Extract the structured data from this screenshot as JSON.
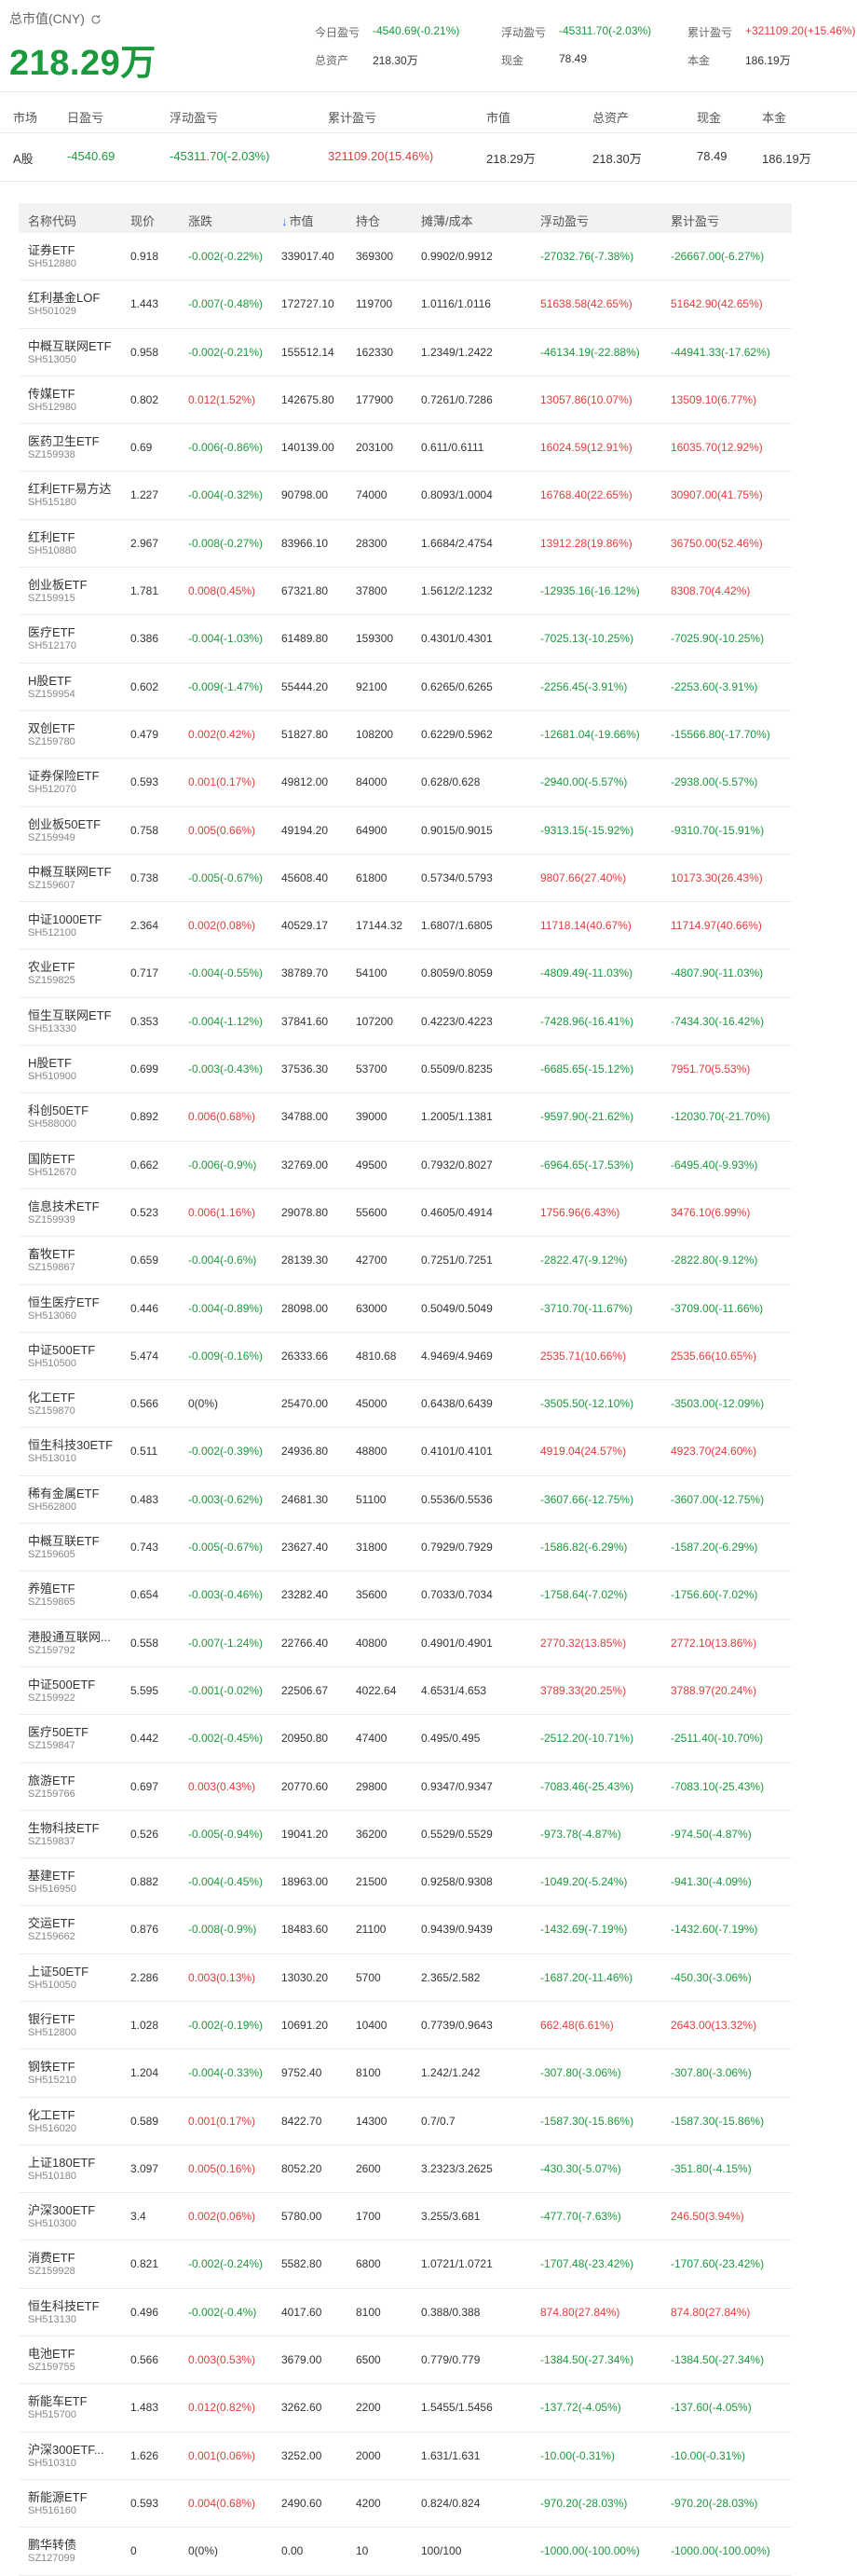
{
  "header": {
    "label": "总市值(CNY)",
    "value": "218.29万",
    "stats": {
      "today_label": "今日盈亏",
      "today_value": "-4540.69(-0.21%)",
      "float_label": "浮动盈亏",
      "float_value": "-45311.70(-2.03%)",
      "cum_label": "累计盈亏",
      "cum_value": "+321109.20(+15.46%)",
      "assets_label": "总资产",
      "assets_value": "218.30万",
      "cash_label": "现金",
      "cash_value": "78.49",
      "principal_label": "本金",
      "principal_value": "186.19万"
    }
  },
  "summary": {
    "headers": [
      "市场",
      "日盈亏",
      "浮动盈亏",
      "累计盈亏",
      "市值",
      "总资产",
      "现金",
      "本金"
    ],
    "row": [
      "A股",
      "-4540.69",
      "-45311.70(-2.03%)",
      "321109.20(15.46%)",
      "218.29万",
      "218.30万",
      "78.49",
      "186.19万"
    ]
  },
  "colors": {
    "gain": "#e23c3c",
    "loss": "#1a9a3c",
    "accent": "#3a6fd8"
  },
  "table": {
    "headers": [
      "名称代码",
      "现价",
      "涨跌",
      "市值",
      "持仓",
      "摊薄/成本",
      "浮动盈亏",
      "累计盈亏"
    ],
    "sort_icon": "arrow-down-icon",
    "rows": [
      {
        "name": "证券ETF",
        "code": "SH512880",
        "price": "0.918",
        "change": "-0.002(-0.22%)",
        "mv": "339017.40",
        "qty": "369300",
        "cost": "0.9902/0.9912",
        "fpl": "-27032.76(-7.38%)",
        "cpl": "-26667.00(-6.27%)"
      },
      {
        "name": "红利基金LOF",
        "code": "SH501029",
        "price": "1.443",
        "change": "-0.007(-0.48%)",
        "mv": "172727.10",
        "qty": "119700",
        "cost": "1.0116/1.0116",
        "fpl": "51638.58(42.65%)",
        "cpl": "51642.90(42.65%)"
      },
      {
        "name": "中概互联网ETF",
        "code": "SH513050",
        "price": "0.958",
        "change": "-0.002(-0.21%)",
        "mv": "155512.14",
        "qty": "162330",
        "cost": "1.2349/1.2422",
        "fpl": "-46134.19(-22.88%)",
        "cpl": "-44941.33(-17.62%)"
      },
      {
        "name": "传媒ETF",
        "code": "SH512980",
        "price": "0.802",
        "change": "0.012(1.52%)",
        "mv": "142675.80",
        "qty": "177900",
        "cost": "0.7261/0.7286",
        "fpl": "13057.86(10.07%)",
        "cpl": "13509.10(6.77%)"
      },
      {
        "name": "医药卫生ETF",
        "code": "SZ159938",
        "price": "0.69",
        "change": "-0.006(-0.86%)",
        "mv": "140139.00",
        "qty": "203100",
        "cost": "0.611/0.6111",
        "fpl": "16024.59(12.91%)",
        "cpl": "16035.70(12.92%)"
      },
      {
        "name": "红利ETF易方达",
        "code": "SH515180",
        "price": "1.227",
        "change": "-0.004(-0.32%)",
        "mv": "90798.00",
        "qty": "74000",
        "cost": "0.8093/1.0004",
        "fpl": "16768.40(22.65%)",
        "cpl": "30907.00(41.75%)"
      },
      {
        "name": "红利ETF",
        "code": "SH510880",
        "price": "2.967",
        "change": "-0.008(-0.27%)",
        "mv": "83966.10",
        "qty": "28300",
        "cost": "1.6684/2.4754",
        "fpl": "13912.28(19.86%)",
        "cpl": "36750.00(52.46%)"
      },
      {
        "name": "创业板ETF",
        "code": "SZ159915",
        "price": "1.781",
        "change": "0.008(0.45%)",
        "mv": "67321.80",
        "qty": "37800",
        "cost": "1.5612/2.1232",
        "fpl": "-12935.16(-16.12%)",
        "cpl": "8308.70(4.42%)"
      },
      {
        "name": "医疗ETF",
        "code": "SH512170",
        "price": "0.386",
        "change": "-0.004(-1.03%)",
        "mv": "61489.80",
        "qty": "159300",
        "cost": "0.4301/0.4301",
        "fpl": "-7025.13(-10.25%)",
        "cpl": "-7025.90(-10.25%)"
      },
      {
        "name": "H股ETF",
        "code": "SZ159954",
        "price": "0.602",
        "change": "-0.009(-1.47%)",
        "mv": "55444.20",
        "qty": "92100",
        "cost": "0.6265/0.6265",
        "fpl": "-2256.45(-3.91%)",
        "cpl": "-2253.60(-3.91%)"
      },
      {
        "name": "双创ETF",
        "code": "SZ159780",
        "price": "0.479",
        "change": "0.002(0.42%)",
        "mv": "51827.80",
        "qty": "108200",
        "cost": "0.6229/0.5962",
        "fpl": "-12681.04(-19.66%)",
        "cpl": "-15566.80(-17.70%)"
      },
      {
        "name": "证券保险ETF",
        "code": "SH512070",
        "price": "0.593",
        "change": "0.001(0.17%)",
        "mv": "49812.00",
        "qty": "84000",
        "cost": "0.628/0.628",
        "fpl": "-2940.00(-5.57%)",
        "cpl": "-2938.00(-5.57%)"
      },
      {
        "name": "创业板50ETF",
        "code": "SZ159949",
        "price": "0.758",
        "change": "0.005(0.66%)",
        "mv": "49194.20",
        "qty": "64900",
        "cost": "0.9015/0.9015",
        "fpl": "-9313.15(-15.92%)",
        "cpl": "-9310.70(-15.91%)"
      },
      {
        "name": "中概互联网ETF",
        "code": "SZ159607",
        "price": "0.738",
        "change": "-0.005(-0.67%)",
        "mv": "45608.40",
        "qty": "61800",
        "cost": "0.5734/0.5793",
        "fpl": "9807.66(27.40%)",
        "cpl": "10173.30(26.43%)"
      },
      {
        "name": "中证1000ETF",
        "code": "SH512100",
        "price": "2.364",
        "change": "0.002(0.08%)",
        "mv": "40529.17",
        "qty": "17144.32",
        "cost": "1.6807/1.6805",
        "fpl": "11718.14(40.67%)",
        "cpl": "11714.97(40.66%)"
      },
      {
        "name": "农业ETF",
        "code": "SZ159825",
        "price": "0.717",
        "change": "-0.004(-0.55%)",
        "mv": "38789.70",
        "qty": "54100",
        "cost": "0.8059/0.8059",
        "fpl": "-4809.49(-11.03%)",
        "cpl": "-4807.90(-11.03%)"
      },
      {
        "name": "恒生互联网ETF",
        "code": "SH513330",
        "price": "0.353",
        "change": "-0.004(-1.12%)",
        "mv": "37841.60",
        "qty": "107200",
        "cost": "0.4223/0.4223",
        "fpl": "-7428.96(-16.41%)",
        "cpl": "-7434.30(-16.42%)"
      },
      {
        "name": "H股ETF",
        "code": "SH510900",
        "price": "0.699",
        "change": "-0.003(-0.43%)",
        "mv": "37536.30",
        "qty": "53700",
        "cost": "0.5509/0.8235",
        "fpl": "-6685.65(-15.12%)",
        "cpl": "7951.70(5.53%)"
      },
      {
        "name": "科创50ETF",
        "code": "SH588000",
        "price": "0.892",
        "change": "0.006(0.68%)",
        "mv": "34788.00",
        "qty": "39000",
        "cost": "1.2005/1.1381",
        "fpl": "-9597.90(-21.62%)",
        "cpl": "-12030.70(-21.70%)"
      },
      {
        "name": "国防ETF",
        "code": "SH512670",
        "price": "0.662",
        "change": "-0.006(-0.9%)",
        "mv": "32769.00",
        "qty": "49500",
        "cost": "0.7932/0.8027",
        "fpl": "-6964.65(-17.53%)",
        "cpl": "-6495.40(-9.93%)"
      },
      {
        "name": "信息技术ETF",
        "code": "SZ159939",
        "price": "0.523",
        "change": "0.006(1.16%)",
        "mv": "29078.80",
        "qty": "55600",
        "cost": "0.4605/0.4914",
        "fpl": "1756.96(6.43%)",
        "cpl": "3476.10(6.99%)"
      },
      {
        "name": "畜牧ETF",
        "code": "SZ159867",
        "price": "0.659",
        "change": "-0.004(-0.6%)",
        "mv": "28139.30",
        "qty": "42700",
        "cost": "0.7251/0.7251",
        "fpl": "-2822.47(-9.12%)",
        "cpl": "-2822.80(-9.12%)"
      },
      {
        "name": "恒生医疗ETF",
        "code": "SH513060",
        "price": "0.446",
        "change": "-0.004(-0.89%)",
        "mv": "28098.00",
        "qty": "63000",
        "cost": "0.5049/0.5049",
        "fpl": "-3710.70(-11.67%)",
        "cpl": "-3709.00(-11.66%)"
      },
      {
        "name": "中证500ETF",
        "code": "SH510500",
        "price": "5.474",
        "change": "-0.009(-0.16%)",
        "mv": "26333.66",
        "qty": "4810.68",
        "cost": "4.9469/4.9469",
        "fpl": "2535.71(10.66%)",
        "cpl": "2535.66(10.65%)"
      },
      {
        "name": "化工ETF",
        "code": "SZ159870",
        "price": "0.566",
        "change": "0(0%)",
        "mv": "25470.00",
        "qty": "45000",
        "cost": "0.6438/0.6439",
        "fpl": "-3505.50(-12.10%)",
        "cpl": "-3503.00(-12.09%)"
      },
      {
        "name": "恒生科技30ETF",
        "code": "SH513010",
        "price": "0.511",
        "change": "-0.002(-0.39%)",
        "mv": "24936.80",
        "qty": "48800",
        "cost": "0.4101/0.4101",
        "fpl": "4919.04(24.57%)",
        "cpl": "4923.70(24.60%)"
      },
      {
        "name": "稀有金属ETF",
        "code": "SH562800",
        "price": "0.483",
        "change": "-0.003(-0.62%)",
        "mv": "24681.30",
        "qty": "51100",
        "cost": "0.5536/0.5536",
        "fpl": "-3607.66(-12.75%)",
        "cpl": "-3607.00(-12.75%)"
      },
      {
        "name": "中概互联ETF",
        "code": "SZ159605",
        "price": "0.743",
        "change": "-0.005(-0.67%)",
        "mv": "23627.40",
        "qty": "31800",
        "cost": "0.7929/0.7929",
        "fpl": "-1586.82(-6.29%)",
        "cpl": "-1587.20(-6.29%)"
      },
      {
        "name": "养殖ETF",
        "code": "SZ159865",
        "price": "0.654",
        "change": "-0.003(-0.46%)",
        "mv": "23282.40",
        "qty": "35600",
        "cost": "0.7033/0.7034",
        "fpl": "-1758.64(-7.02%)",
        "cpl": "-1756.60(-7.02%)"
      },
      {
        "name": "港股通互联网...",
        "code": "SZ159792",
        "price": "0.558",
        "change": "-0.007(-1.24%)",
        "mv": "22766.40",
        "qty": "40800",
        "cost": "0.4901/0.4901",
        "fpl": "2770.32(13.85%)",
        "cpl": "2772.10(13.86%)"
      },
      {
        "name": "中证500ETF",
        "code": "SZ159922",
        "price": "5.595",
        "change": "-0.001(-0.02%)",
        "mv": "22506.67",
        "qty": "4022.64",
        "cost": "4.6531/4.653",
        "fpl": "3789.33(20.25%)",
        "cpl": "3788.97(20.24%)"
      },
      {
        "name": "医疗50ETF",
        "code": "SZ159847",
        "price": "0.442",
        "change": "-0.002(-0.45%)",
        "mv": "20950.80",
        "qty": "47400",
        "cost": "0.495/0.495",
        "fpl": "-2512.20(-10.71%)",
        "cpl": "-2511.40(-10.70%)"
      },
      {
        "name": "旅游ETF",
        "code": "SZ159766",
        "price": "0.697",
        "change": "0.003(0.43%)",
        "mv": "20770.60",
        "qty": "29800",
        "cost": "0.9347/0.9347",
        "fpl": "-7083.46(-25.43%)",
        "cpl": "-7083.10(-25.43%)"
      },
      {
        "name": "生物科技ETF",
        "code": "SZ159837",
        "price": "0.526",
        "change": "-0.005(-0.94%)",
        "mv": "19041.20",
        "qty": "36200",
        "cost": "0.5529/0.5529",
        "fpl": "-973.78(-4.87%)",
        "cpl": "-974.50(-4.87%)"
      },
      {
        "name": "基建ETF",
        "code": "SH516950",
        "price": "0.882",
        "change": "-0.004(-0.45%)",
        "mv": "18963.00",
        "qty": "21500",
        "cost": "0.9258/0.9308",
        "fpl": "-1049.20(-5.24%)",
        "cpl": "-941.30(-4.09%)"
      },
      {
        "name": "交运ETF",
        "code": "SZ159662",
        "price": "0.876",
        "change": "-0.008(-0.9%)",
        "mv": "18483.60",
        "qty": "21100",
        "cost": "0.9439/0.9439",
        "fpl": "-1432.69(-7.19%)",
        "cpl": "-1432.60(-7.19%)"
      },
      {
        "name": "上证50ETF",
        "code": "SH510050",
        "price": "2.286",
        "change": "0.003(0.13%)",
        "mv": "13030.20",
        "qty": "5700",
        "cost": "2.365/2.582",
        "fpl": "-1687.20(-11.46%)",
        "cpl": "-450.30(-3.06%)"
      },
      {
        "name": "银行ETF",
        "code": "SH512800",
        "price": "1.028",
        "change": "-0.002(-0.19%)",
        "mv": "10691.20",
        "qty": "10400",
        "cost": "0.7739/0.9643",
        "fpl": "662.48(6.61%)",
        "cpl": "2643.00(13.32%)"
      },
      {
        "name": "钢铁ETF",
        "code": "SH515210",
        "price": "1.204",
        "change": "-0.004(-0.33%)",
        "mv": "9752.40",
        "qty": "8100",
        "cost": "1.242/1.242",
        "fpl": "-307.80(-3.06%)",
        "cpl": "-307.80(-3.06%)"
      },
      {
        "name": "化工ETF",
        "code": "SH516020",
        "price": "0.589",
        "change": "0.001(0.17%)",
        "mv": "8422.70",
        "qty": "14300",
        "cost": "0.7/0.7",
        "fpl": "-1587.30(-15.86%)",
        "cpl": "-1587.30(-15.86%)"
      },
      {
        "name": "上证180ETF",
        "code": "SH510180",
        "price": "3.097",
        "change": "0.005(0.16%)",
        "mv": "8052.20",
        "qty": "2600",
        "cost": "3.2323/3.2625",
        "fpl": "-430.30(-5.07%)",
        "cpl": "-351.80(-4.15%)"
      },
      {
        "name": "沪深300ETF",
        "code": "SH510300",
        "price": "3.4",
        "change": "0.002(0.06%)",
        "mv": "5780.00",
        "qty": "1700",
        "cost": "3.255/3.681",
        "fpl": "-477.70(-7.63%)",
        "cpl": "246.50(3.94%)"
      },
      {
        "name": "消费ETF",
        "code": "SZ159928",
        "price": "0.821",
        "change": "-0.002(-0.24%)",
        "mv": "5582.80",
        "qty": "6800",
        "cost": "1.0721/1.0721",
        "fpl": "-1707.48(-23.42%)",
        "cpl": "-1707.60(-23.42%)"
      },
      {
        "name": "恒生科技ETF",
        "code": "SH513130",
        "price": "0.496",
        "change": "-0.002(-0.4%)",
        "mv": "4017.60",
        "qty": "8100",
        "cost": "0.388/0.388",
        "fpl": "874.80(27.84%)",
        "cpl": "874.80(27.84%)"
      },
      {
        "name": "电池ETF",
        "code": "SZ159755",
        "price": "0.566",
        "change": "0.003(0.53%)",
        "mv": "3679.00",
        "qty": "6500",
        "cost": "0.779/0.779",
        "fpl": "-1384.50(-27.34%)",
        "cpl": "-1384.50(-27.34%)"
      },
      {
        "name": "新能车ETF",
        "code": "SH515700",
        "price": "1.483",
        "change": "0.012(0.82%)",
        "mv": "3262.60",
        "qty": "2200",
        "cost": "1.5455/1.5456",
        "fpl": "-137.72(-4.05%)",
        "cpl": "-137.60(-4.05%)"
      },
      {
        "name": "沪深300ETF...",
        "code": "SH510310",
        "price": "1.626",
        "change": "0.001(0.06%)",
        "mv": "3252.00",
        "qty": "2000",
        "cost": "1.631/1.631",
        "fpl": "-10.00(-0.31%)",
        "cpl": "-10.00(-0.31%)"
      },
      {
        "name": "新能源ETF",
        "code": "SH516160",
        "price": "0.593",
        "change": "0.004(0.68%)",
        "mv": "2490.60",
        "qty": "4200",
        "cost": "0.824/0.824",
        "fpl": "-970.20(-28.03%)",
        "cpl": "-970.20(-28.03%)"
      },
      {
        "name": "鹏华转债",
        "code": "SZ127099",
        "price": "0",
        "change": "0(0%)",
        "mv": "0.00",
        "qty": "10",
        "cost": "100/100",
        "fpl": "-1000.00(-100.00%)",
        "cpl": "-1000.00(-100.00%)"
      }
    ]
  }
}
